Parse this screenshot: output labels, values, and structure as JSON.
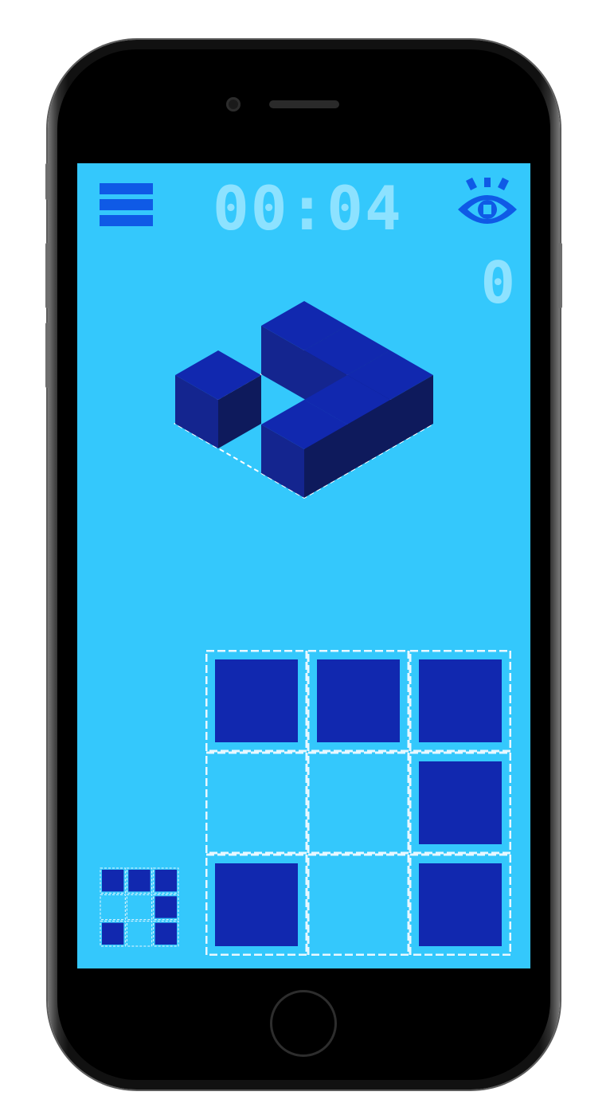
{
  "hud": {
    "timer": "00:04",
    "score": "0",
    "menu_icon": "hamburger-menu-icon",
    "eye_icon": "eye-icon"
  },
  "puzzle": {
    "grid_size": 3,
    "filled_cells": [
      [
        true,
        true,
        true
      ],
      [
        false,
        false,
        true
      ],
      [
        true,
        false,
        true
      ]
    ]
  },
  "colors": {
    "background": "#34c8fc",
    "tile": "#1128af",
    "block_top": "#1128af",
    "block_left": "#14258f",
    "block_right": "#0e1a5c",
    "hud_text": "#8de2ff",
    "icon_blue": "#0f5ae6"
  }
}
